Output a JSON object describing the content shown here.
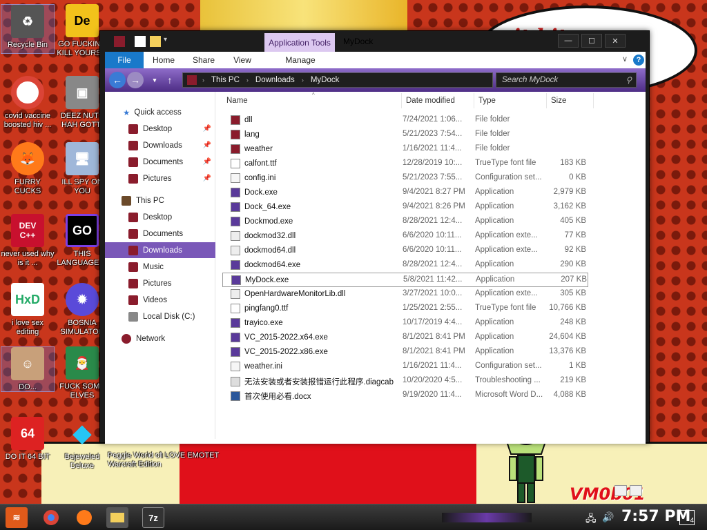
{
  "desktop": {
    "icons": [
      {
        "label": "Recycle Bin"
      },
      {
        "label": "GO FUCKING KILL YOURS..."
      },
      {
        "label": "covid vaccine boosted hiv ..."
      },
      {
        "label": "DEEZ NUTS HAH GOTTI"
      },
      {
        "label": "FURRY CUCKS"
      },
      {
        "label": "ILL SPY ON YOU"
      },
      {
        "label": "never used why is it ..."
      },
      {
        "label": "THIS LANGUAGE ..."
      },
      {
        "label": "i love sex editing"
      },
      {
        "label": "BOSNIA SIMULATOR"
      },
      {
        "label": "DO..."
      },
      {
        "label": "FUCK SOME ELVES"
      },
      {
        "label": "DO IT 64 BIT"
      },
      {
        "label": "Bejeweled Deluxe"
      },
      {
        "label": "Peggle World of Warcraft Edition"
      },
      {
        "label": "I LOVE EMOTET"
      }
    ],
    "wallpaper_text": "...it hit ...w",
    "wallpaper_signature": "VM0b01"
  },
  "window": {
    "title": "MyDock",
    "contextual_tab_group": "Application Tools",
    "ribbon_tabs": [
      "File",
      "Home",
      "Share",
      "View",
      "Manage"
    ],
    "help_label": "?",
    "address": [
      "This PC",
      "Downloads",
      "MyDock"
    ],
    "search_placeholder": "Search MyDock",
    "caption": {
      "minimize": "—",
      "maximize": "☐",
      "close": "✕"
    }
  },
  "nav": [
    {
      "label": "Quick access"
    },
    {
      "label": "Desktop"
    },
    {
      "label": "Downloads"
    },
    {
      "label": "Documents"
    },
    {
      "label": "Pictures"
    },
    {
      "label": "This PC"
    },
    {
      "label": "Desktop"
    },
    {
      "label": "Documents"
    },
    {
      "label": "Downloads"
    },
    {
      "label": "Music"
    },
    {
      "label": "Pictures"
    },
    {
      "label": "Videos"
    },
    {
      "label": "Local Disk (C:)"
    },
    {
      "label": "Network"
    }
  ],
  "columns": {
    "name": "Name",
    "date": "Date modified",
    "type": "Type",
    "size": "Size"
  },
  "files": [
    {
      "name": "dll",
      "date": "7/24/2021 1:06...",
      "type": "File folder",
      "size": ""
    },
    {
      "name": "lang",
      "date": "5/21/2023 7:54...",
      "type": "File folder",
      "size": ""
    },
    {
      "name": "weather",
      "date": "1/16/2021 11:4...",
      "type": "File folder",
      "size": ""
    },
    {
      "name": "calfont.ttf",
      "date": "12/28/2019 10:...",
      "type": "TrueType font file",
      "size": "183 KB"
    },
    {
      "name": "config.ini",
      "date": "5/21/2023 7:55...",
      "type": "Configuration set...",
      "size": "0 KB"
    },
    {
      "name": "Dock.exe",
      "date": "9/4/2021 8:27 PM",
      "type": "Application",
      "size": "2,979 KB"
    },
    {
      "name": "Dock_64.exe",
      "date": "9/4/2021 8:26 PM",
      "type": "Application",
      "size": "3,162 KB"
    },
    {
      "name": "Dockmod.exe",
      "date": "8/28/2021 12:4...",
      "type": "Application",
      "size": "405 KB"
    },
    {
      "name": "dockmod32.dll",
      "date": "6/6/2020 10:11...",
      "type": "Application exte...",
      "size": "77 KB"
    },
    {
      "name": "dockmod64.dll",
      "date": "6/6/2020 10:11...",
      "type": "Application exte...",
      "size": "92 KB"
    },
    {
      "name": "dockmod64.exe",
      "date": "8/28/2021 12:4...",
      "type": "Application",
      "size": "290 KB"
    },
    {
      "name": "MyDock.exe",
      "date": "5/8/2021 11:42...",
      "type": "Application",
      "size": "207 KB"
    },
    {
      "name": "OpenHardwareMonitorLib.dll",
      "date": "3/27/2021 10:0...",
      "type": "Application exte...",
      "size": "305 KB"
    },
    {
      "name": "pingfang0.ttf",
      "date": "1/25/2021 2:55...",
      "type": "TrueType font file",
      "size": "10,766 KB"
    },
    {
      "name": "trayico.exe",
      "date": "10/17/2019 4:4...",
      "type": "Application",
      "size": "248 KB"
    },
    {
      "name": "VC_2015-2022.x64.exe",
      "date": "8/1/2021 8:41 PM",
      "type": "Application",
      "size": "24,604 KB"
    },
    {
      "name": "VC_2015-2022.x86.exe",
      "date": "8/1/2021 8:41 PM",
      "type": "Application",
      "size": "13,376 KB"
    },
    {
      "name": "weather.ini",
      "date": "1/16/2021 11:4...",
      "type": "Configuration set...",
      "size": "1 KB"
    },
    {
      "name": "无法安装或者安装报错运行此程序.diagcab",
      "date": "10/20/2020 4:5...",
      "type": "Troubleshooting ...",
      "size": "219 KB"
    },
    {
      "name": "首次使用必看.docx",
      "date": "9/19/2020 11:4...",
      "type": "Microsoft Word D...",
      "size": "4,088 KB"
    }
  ],
  "taskbar": {
    "apps": [
      "start-button",
      "chrome",
      "firefox",
      "file-explorer",
      "7zip"
    ],
    "sevenzip_label": "7z",
    "time": "7:57 PM",
    "notification_count": "4"
  }
}
